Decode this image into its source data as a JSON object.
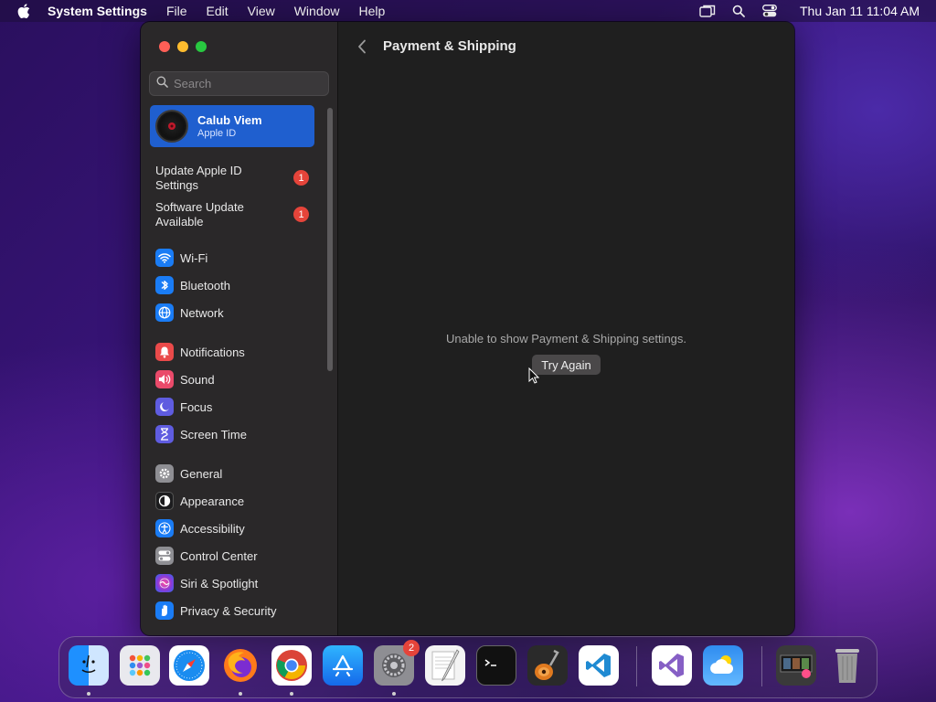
{
  "menubar": {
    "app_name": "System Settings",
    "menus": [
      "File",
      "Edit",
      "View",
      "Window",
      "Help"
    ],
    "clock": "Thu Jan 11  11:04 AM"
  },
  "sidebar": {
    "search_placeholder": "Search",
    "account": {
      "name": "Calub Viem",
      "subtitle": "Apple ID"
    },
    "notices": [
      {
        "label": "Update Apple ID Settings",
        "badge": "1"
      },
      {
        "label": "Software Update Available",
        "badge": "1"
      }
    ],
    "items": [
      {
        "label": "Wi-Fi",
        "icon": "wifi-icon",
        "color": "#1a7cf5"
      },
      {
        "label": "Bluetooth",
        "icon": "bluetooth-icon",
        "color": "#1a7cf5"
      },
      {
        "label": "Network",
        "icon": "globe-icon",
        "color": "#1a7cf5"
      },
      {
        "label": "Notifications",
        "icon": "bell-icon",
        "color": "#ea4a4a"
      },
      {
        "label": "Sound",
        "icon": "speaker-icon",
        "color": "#ea4a6a"
      },
      {
        "label": "Focus",
        "icon": "moon-icon",
        "color": "#5f5ce0"
      },
      {
        "label": "Screen Time",
        "icon": "hourglass-icon",
        "color": "#5f5ce0"
      },
      {
        "label": "General",
        "icon": "gear-icon",
        "color": "#8e8e93"
      },
      {
        "label": "Appearance",
        "icon": "appearance-icon",
        "color": "#1c1c1e"
      },
      {
        "label": "Accessibility",
        "icon": "accessibility-icon",
        "color": "#1a7cf5"
      },
      {
        "label": "Control Center",
        "icon": "switches-icon",
        "color": "#8e8e93"
      },
      {
        "label": "Siri & Spotlight",
        "icon": "siri-icon",
        "color": "#8a3ad8"
      },
      {
        "label": "Privacy & Security",
        "icon": "hand-icon",
        "color": "#1a7cf5"
      }
    ]
  },
  "main": {
    "title": "Payment & Shipping",
    "error": "Unable to show Payment & Shipping settings.",
    "retry_label": "Try Again"
  },
  "dock": {
    "apps": [
      "Finder",
      "Launchpad",
      "Safari",
      "Firefox",
      "Chrome",
      "App Store",
      "System Settings",
      "TextEdit",
      "Terminal",
      "GarageBand",
      "Visual Studio Code",
      "Visual Studio",
      "Weather",
      "Photo Booth",
      "Trash"
    ],
    "system_settings_badge": "2"
  },
  "colors": {
    "accent": "#1f5fcf",
    "badge": "#e5443a"
  }
}
